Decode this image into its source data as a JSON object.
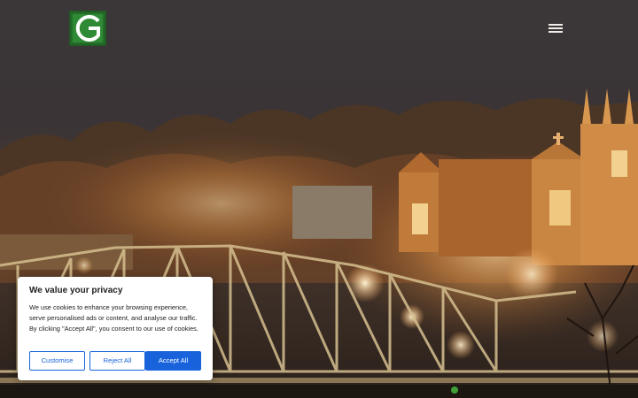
{
  "header": {
    "logo_icon": "g-letter-logo",
    "menu_icon": "hamburger-menu-icon"
  },
  "hero": {
    "image": "night-town-bridge-church-photo"
  },
  "cookie_banner": {
    "title": "We value your privacy",
    "text": "We use cookies to enhance your browsing experience, serve personalised ads or content, and analyse our traffic. By clicking \"Accept All\", you consent to our use of cookies.",
    "customise_label": "Customise",
    "reject_label": "Reject All",
    "accept_label": "Accept All",
    "accent_color": "#1863dc"
  }
}
